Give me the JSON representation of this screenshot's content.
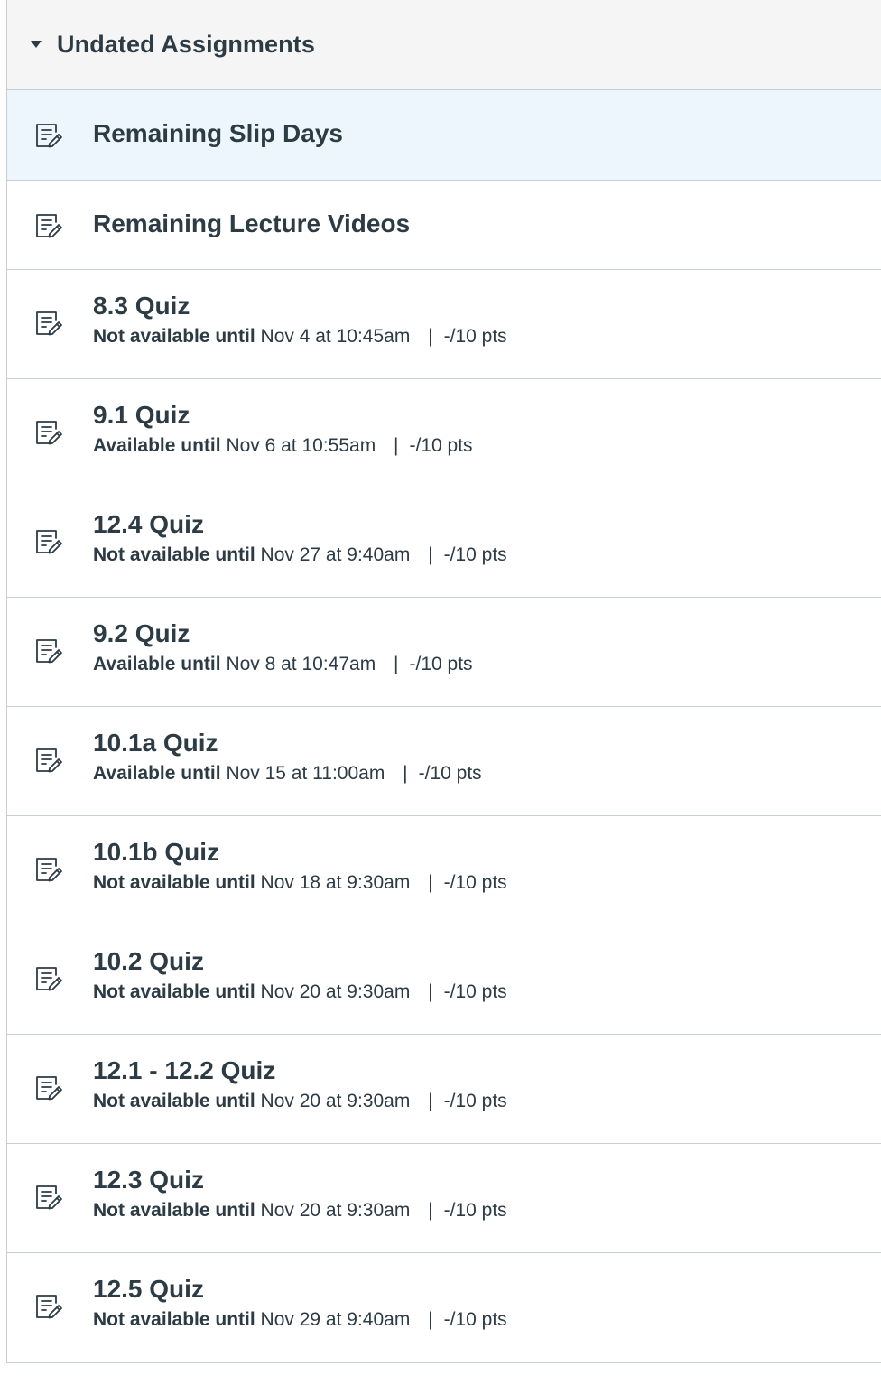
{
  "group": {
    "title": "Undated Assignments"
  },
  "assignments": [
    {
      "title": "Remaining Slip Days"
    },
    {
      "title": "Remaining Lecture Videos"
    },
    {
      "title": "8.3 Quiz",
      "status": "Not available until",
      "date": "Nov 4 at 10:45am",
      "sep": "|",
      "points": "-/10 pts"
    },
    {
      "title": "9.1 Quiz",
      "status": "Available until",
      "date": "Nov 6 at 10:55am",
      "sep": "|",
      "points": "-/10 pts"
    },
    {
      "title": "12.4 Quiz",
      "status": "Not available until",
      "date": "Nov 27 at 9:40am",
      "sep": "|",
      "points": "-/10 pts"
    },
    {
      "title": "9.2 Quiz",
      "status": "Available until",
      "date": "Nov 8 at 10:47am",
      "sep": "|",
      "points": "-/10 pts"
    },
    {
      "title": "10.1a Quiz",
      "status": "Available until",
      "date": "Nov 15 at 11:00am",
      "sep": "|",
      "points": "-/10 pts"
    },
    {
      "title": "10.1b Quiz",
      "status": "Not available until",
      "date": "Nov 18 at 9:30am",
      "sep": "|",
      "points": "-/10 pts"
    },
    {
      "title": "10.2 Quiz",
      "status": "Not available until",
      "date": "Nov 20 at 9:30am",
      "sep": "|",
      "points": "-/10 pts"
    },
    {
      "title": "12.1 - 12.2 Quiz",
      "status": "Not available until",
      "date": "Nov 20 at 9:30am",
      "sep": "|",
      "points": "-/10 pts"
    },
    {
      "title": "12.3 Quiz",
      "status": "Not available until",
      "date": "Nov 20 at 9:30am",
      "sep": "|",
      "points": "-/10 pts"
    },
    {
      "title": "12.5 Quiz",
      "status": "Not available until",
      "date": "Nov 29 at 9:40am",
      "sep": "|",
      "points": "-/10 pts"
    }
  ],
  "icons": {
    "group_toggle": "caret-down-icon",
    "assignment": "assignment-icon"
  },
  "colors": {
    "text": "#2d3b45",
    "header_bg": "#f5f5f5",
    "highlight_bg": "#eef6fd",
    "border": "#c7cdd1"
  }
}
